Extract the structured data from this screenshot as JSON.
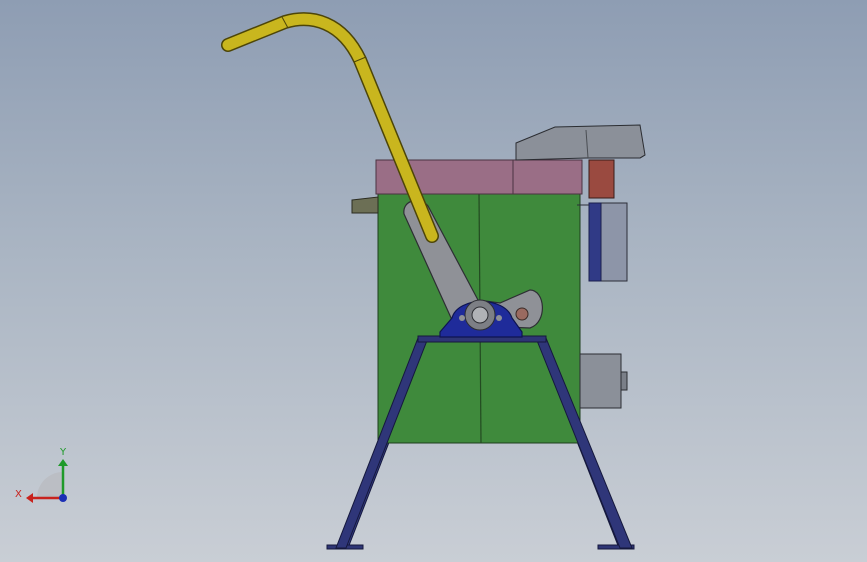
{
  "viewport": {
    "background_top": "#8e9db3",
    "background_bottom": "#c9ced5"
  },
  "model": {
    "parts": [
      "tank-body",
      "top-lid-band",
      "handle-pipe",
      "lever-arm",
      "pillow-block-bearing",
      "support-frame",
      "chute",
      "side-bracket",
      "side-box-upper",
      "side-box-lower",
      "left-tab"
    ],
    "colors": {
      "tank": "#3f8a3c",
      "lid_band": "#9a6e86",
      "pipe": "#c9b61e",
      "frame": "#2e3575",
      "bearing": "#1f2b9a",
      "lever": "#8f9197",
      "chute": "#8b9099",
      "bracket": "#9a4a40"
    }
  },
  "triad": {
    "x_label": "X",
    "y_label": "Y",
    "x_color": "#c8221d",
    "y_color": "#1f9a2a",
    "z_color": "#1b2fb5"
  }
}
